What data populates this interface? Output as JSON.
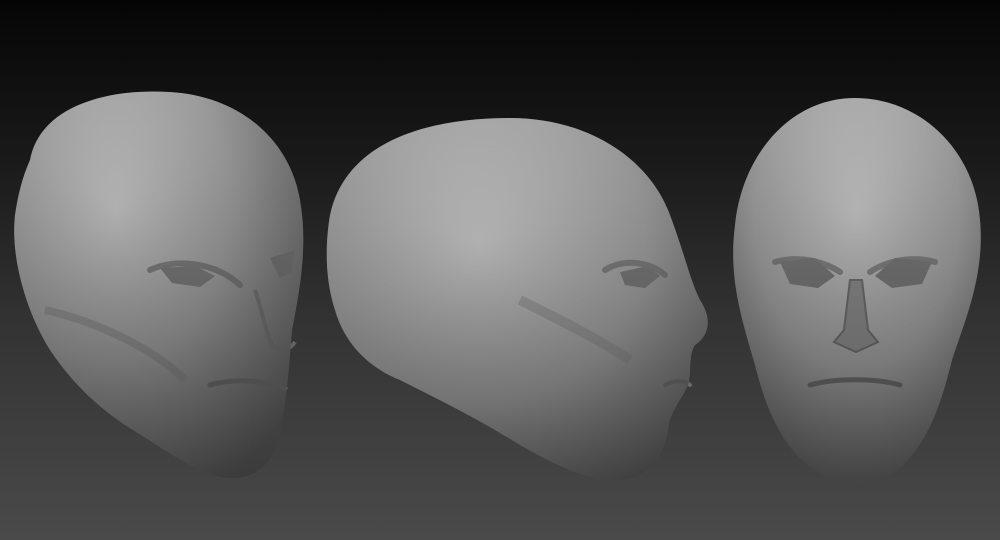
{
  "scene": {
    "background": {
      "top_color": "#050505",
      "bottom_color": "#4a4a4a"
    },
    "material_color": "#9a9a9a",
    "objects": [
      {
        "id": "head-three-quarter",
        "view": "three-quarter"
      },
      {
        "id": "head-side",
        "view": "profile"
      },
      {
        "id": "head-front",
        "view": "front"
      }
    ]
  }
}
